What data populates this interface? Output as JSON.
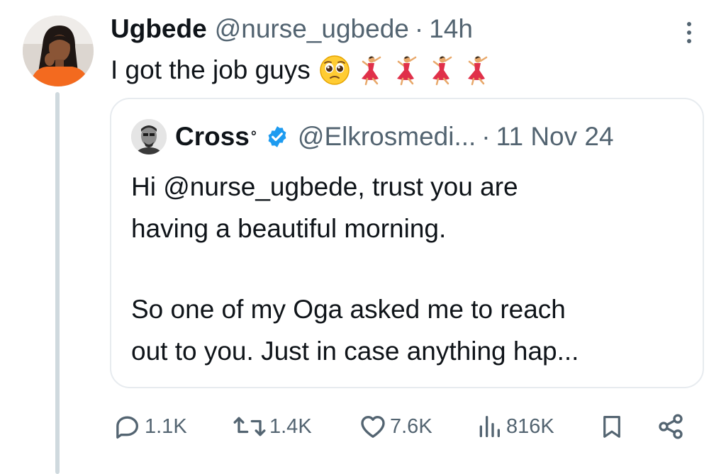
{
  "tweet": {
    "author_name": "Ugbede",
    "author_handle": "@nurse_ugbede",
    "separator": "·",
    "timestamp": "14h",
    "text": "I got the job guys",
    "emojis": [
      "pleading-face-emoji",
      "woman-dancing-emoji",
      "woman-dancing-emoji",
      "woman-dancing-emoji",
      "woman-dancing-emoji"
    ]
  },
  "quote": {
    "author_name": "Cross",
    "author_suffix": "°",
    "verified": true,
    "author_handle": "@Elkrosmedi...",
    "separator": "·",
    "timestamp": "11 Nov 24",
    "lines": [
      "Hi @nurse_ugbede, trust you are",
      "having a beautiful morning.",
      "So one of my Oga asked me to reach",
      "out to you. Just in case anything hap..."
    ]
  },
  "actions": {
    "replies": "1.1K",
    "reposts": "1.4K",
    "likes": "7.6K",
    "views": "816K"
  },
  "colors": {
    "text": "#0f1419",
    "secondary": "#536471",
    "verified_blue": "#1d9bf0",
    "border": "#e7ebef",
    "thread_line": "#cfd9de",
    "dress_red": "#e0304a"
  },
  "icons": {
    "reply": "reply-icon",
    "repost": "repost-icon",
    "like": "heart-icon",
    "views": "views-icon",
    "bookmark": "bookmark-icon",
    "share": "share-icon",
    "more": "more-icon",
    "verified": "verified-badge-icon"
  }
}
